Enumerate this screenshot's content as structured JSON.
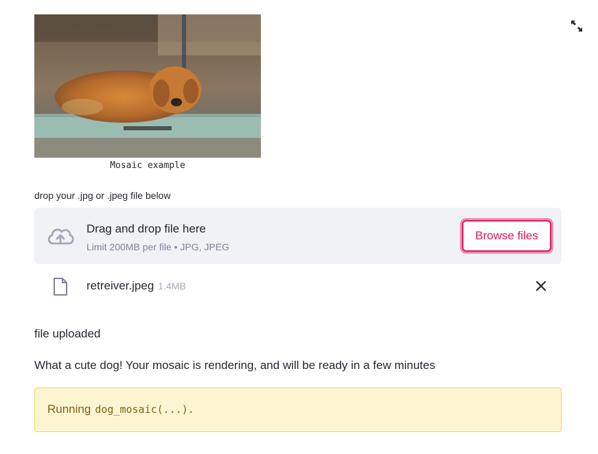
{
  "image": {
    "caption": "Mosaic example"
  },
  "uploader": {
    "label": "drop your .jpg or .jpeg file below",
    "drop_title": "Drag and drop file here",
    "drop_subtitle": "Limit 200MB per file • JPG, JPEG",
    "browse_label": "Browse files",
    "accent_color": "#e0175a"
  },
  "file": {
    "name": "retreiver.jpeg",
    "size": "1.4MB"
  },
  "status": {
    "uploaded": "file uploaded",
    "message": "What a cute dog! Your mosaic is rendering, and will be ready in a few minutes"
  },
  "running": {
    "prefix": "Running",
    "code": "dog_mosaic(...)."
  },
  "icons": {
    "expand": "expand-icon",
    "upload": "cloud-upload-icon",
    "file": "file-icon",
    "remove": "close-icon"
  }
}
